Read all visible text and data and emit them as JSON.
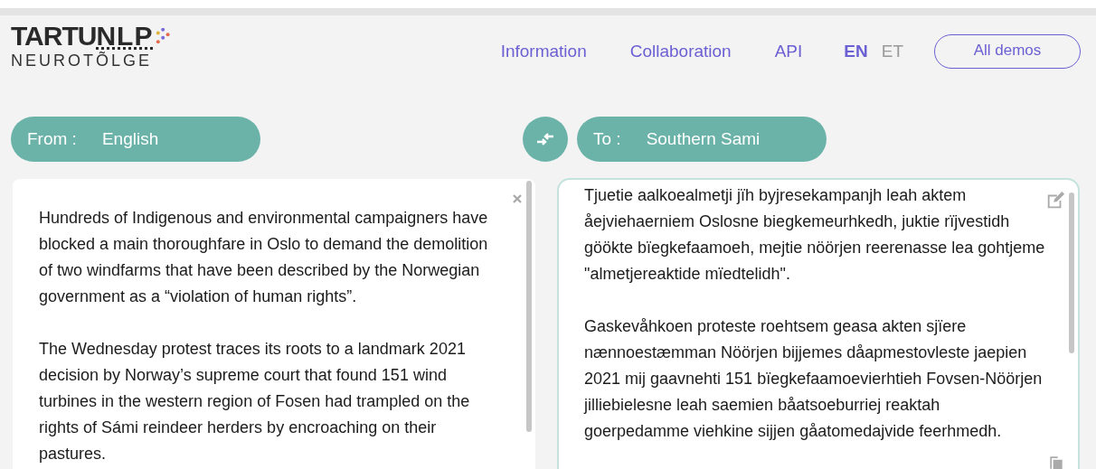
{
  "logo": {
    "primary": "TARTU",
    "secondary": "NLP",
    "subtitle": "NEUROTÕLGE"
  },
  "nav": [
    {
      "label": "Information"
    },
    {
      "label": "Collaboration"
    },
    {
      "label": "API"
    }
  ],
  "languages": [
    {
      "label": "EN",
      "selected": true
    },
    {
      "label": "ET",
      "selected": false
    }
  ],
  "demos_button": "All demos",
  "source": {
    "prefix": "From :",
    "language": "English"
  },
  "target": {
    "prefix": "To :",
    "language": "Southern Sami"
  },
  "input_text": [
    "Hundreds of Indigenous and environmental campaigners have blocked a main thoroughfare in Oslo to demand the demolition of two windfarms that have been described by the Norwegian government as a “violation of human rights”.",
    "The Wednesday protest traces its roots to a landmark 2021 decision by Norway’s supreme court that found 151 wind turbines in the western region of Fosen had trampled on the rights of Sámi reindeer herders by encroaching on their pastures."
  ],
  "output_text": [
    "Tjuetie aalkoealmetji jïh byjresekampanjh leah aktem åejviehaerniem Oslosne biegkemeurhkedh, juktie rïjvestidh göökte bïegkefaamoeh, mejtie nöörjen reerenasse lea gohtjeme \"almetjereaktide mïedtelidh\".",
    "Gaskevåhkoen proteste roehtsem geasa akten sjïere nænnoestæmman Nöörjen bijjemes dåapmestovleste jaepien 2021 mij gaavnehti 151 bïegkefaamoevierhtieh Fovsen-Nöörjen jilliebielesne leah saemien båatsoeburriej reaktah goerpedamme viehkine sijjen gåatomedajvide feerhmedh."
  ]
}
